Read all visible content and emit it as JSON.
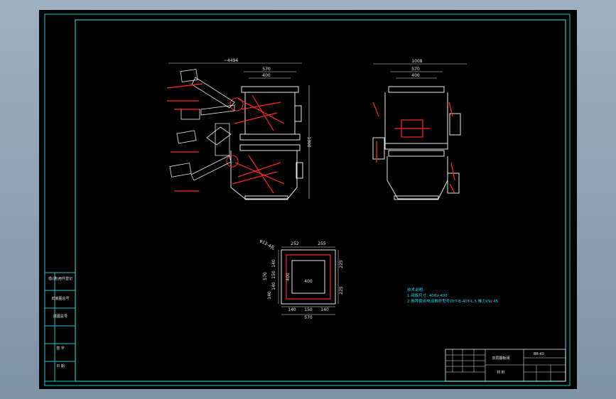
{
  "colors": {
    "background": "#000000",
    "frame": "#27c6c6",
    "outline": "#e8e8e8",
    "highlight": "#ff2a2a",
    "note": "#27d6e6"
  },
  "side_view": {
    "overall_width": "~4494",
    "top_width_570": "570",
    "top_width_400": "400",
    "height": "1300"
  },
  "front_view": {
    "overall_width": "1008",
    "top_width_570": "570",
    "top_width_400": "400"
  },
  "flange_view": {
    "label": "φ12-4孔",
    "top_left": "252",
    "top_right": "255",
    "left_570": "570",
    "left_140a": "140",
    "left_150": "150",
    "left_140b": "140",
    "left_140c": "140",
    "right_225a": "225",
    "right_225b": "225",
    "inner_400_v": "400",
    "inner_400_h": "400",
    "bottom_140a": "140",
    "bottom_150": "150",
    "bottom_140b": "140",
    "bottom_570": "570"
  },
  "notes": {
    "title": "技术说明:",
    "line1": "1.阀板尺寸: 400×400",
    "line2": "2.推荐使用电液推杆型号DYT-B-40T-L.5   推力(N):45"
  },
  "title_block": {
    "drawing_name": "双层翻板阀",
    "part_code": "BR-40",
    "material": "材 料"
  },
  "side_panel": {
    "row1": "借(通)用件登记",
    "row2": "旧底图总号",
    "row3": "底图总号",
    "row4": "签 字",
    "row5": "日 期"
  }
}
